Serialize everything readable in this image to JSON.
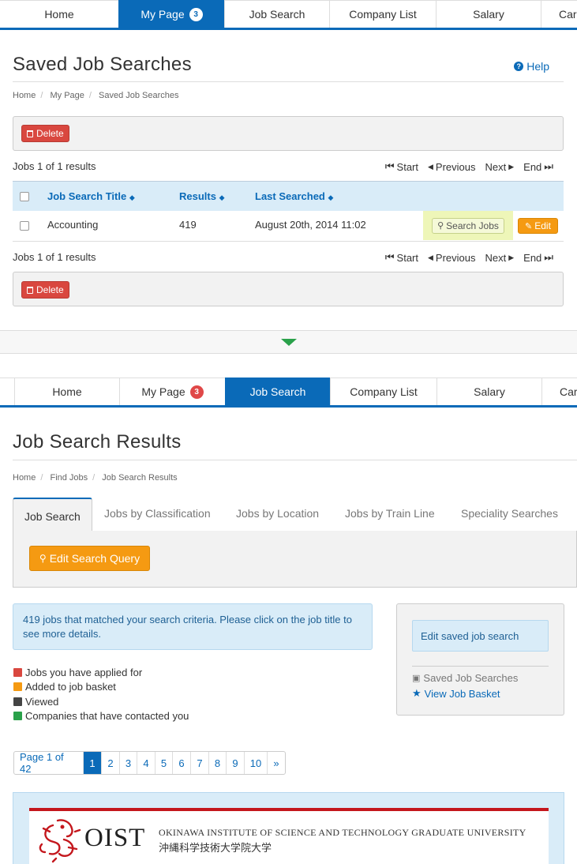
{
  "nav": {
    "items": [
      "Home",
      "My Page",
      "Job Search",
      "Company List",
      "Salary",
      "Car"
    ],
    "badge": "3"
  },
  "saved": {
    "title": "Saved Job Searches",
    "help": "Help",
    "breadcrumb": [
      "Home",
      "My Page",
      "Saved Job Searches"
    ],
    "delete_label": "Delete",
    "count_text": "Jobs 1 of 1 results",
    "pager": {
      "start": "Start",
      "previous": "Previous",
      "next": "Next",
      "end": "End"
    },
    "columns": [
      "Job Search Title",
      "Results",
      "Last Searched"
    ],
    "rows": [
      {
        "title": "Accounting",
        "results": "419",
        "last_searched": "August 20th, 2014 11:02"
      }
    ],
    "search_jobs_label": "Search Jobs",
    "edit_label": "Edit"
  },
  "results": {
    "title": "Job Search Results",
    "breadcrumb": [
      "Home",
      "Find Jobs",
      "Job Search Results"
    ],
    "tabs": [
      "Job Search",
      "Jobs by Classification",
      "Jobs by Location",
      "Jobs by Train Line",
      "Speciality Searches"
    ],
    "edit_query_label": "Edit Search Query",
    "info": "419 jobs that matched your search criteria. Please click on the job title to see more details.",
    "legend": [
      {
        "label": "Jobs you have applied for",
        "color": "#d9473f"
      },
      {
        "label": "Added to job basket",
        "color": "#f59a12"
      },
      {
        "label": "Viewed",
        "color": "#444444"
      },
      {
        "label": "Companies that have contacted you",
        "color": "#2aa14a"
      }
    ],
    "side": {
      "edit_saved": "Edit saved job search",
      "saved_searches": "Saved Job Searches",
      "view_basket": "View Job Basket"
    },
    "pagination": {
      "label": "Page 1 of 42",
      "pages": [
        "1",
        "2",
        "3",
        "4",
        "5",
        "6",
        "7",
        "8",
        "9",
        "10"
      ],
      "next": "»",
      "current": "1"
    }
  },
  "banner": {
    "logo_text": "OIST",
    "name_en": "OKINAWA INSTITUTE OF SCIENCE AND TECHNOLOGY GRADUATE UNIVERSITY",
    "name_jp": "沖縄科学技術大学院大学"
  },
  "colors": {
    "primary": "#0a6ab8",
    "danger": "#d9473f",
    "warning": "#f59a12",
    "success": "#2aa14a",
    "info_bg": "#d9ecf8"
  }
}
